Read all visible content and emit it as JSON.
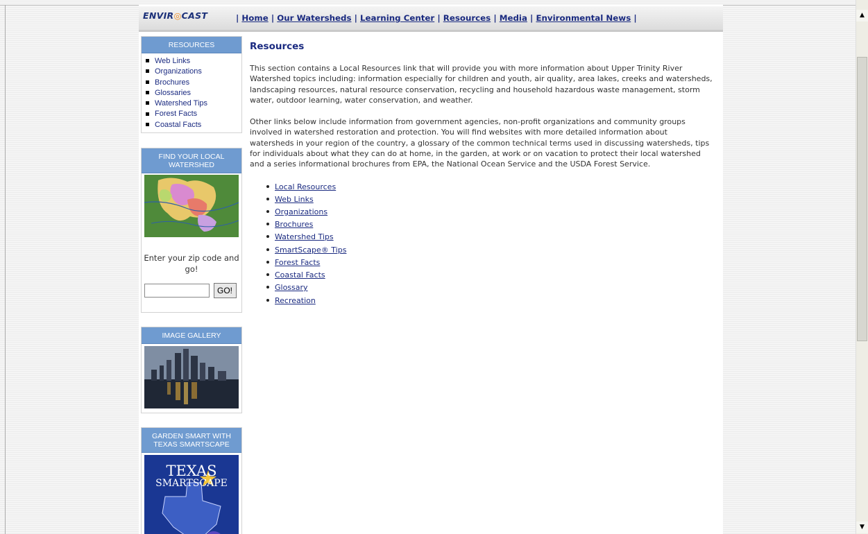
{
  "header": {
    "logo_text_a": "ENVIR",
    "logo_text_b": "CAST",
    "nav": [
      {
        "label": "Home"
      },
      {
        "label": "Our Watersheds"
      },
      {
        "label": "Learning Center"
      },
      {
        "label": "Resources"
      },
      {
        "label": "Media"
      },
      {
        "label": "Environmental News"
      }
    ]
  },
  "sidebar": {
    "resources_title": "RESOURCES",
    "resources_items": [
      "Web Links",
      "Organizations",
      "Brochures",
      "Glossaries",
      "Watershed Tips",
      "Forest Facts",
      "Coastal Facts"
    ],
    "watershed_title": "FIND YOUR LOCAL WATERSHED",
    "zip_label": "Enter your zip code and go!",
    "zip_value": "",
    "go_label": "GO!",
    "gallery_title": "IMAGE GALLERY",
    "smartscape_title": "GARDEN SMART WITH TEXAS SMARTSCAPE",
    "smartscape_img_line1": "TEXAS",
    "smartscape_img_line2": "SMARTSCAPE"
  },
  "main": {
    "title": "Resources",
    "para1": "This section contains a Local Resources link that will provide you with more information about Upper Trinity River Watershed topics including: information especially for children and youth, air quality, area lakes, creeks and watersheds, landscaping resources, natural resource conservation, recycling and household hazardous waste management, storm water, outdoor learning, water conservation, and weather.",
    "para2": "Other links below include information from government agencies, non-profit organizations and community groups involved in watershed restoration and protection. You will find websites with more detailed information about watersheds in your region of the country, a glossary of the common technical terms used in discussing watersheds, tips for individuals about what they can do at home, in the garden, at work or on vacation to protect their local watershed and a series informational brochures from EPA, the National Ocean Service and the USDA Forest Service.",
    "links": [
      "Local Resources",
      "Web Links",
      "Organizations",
      "Brochures",
      "Watershed Tips",
      "SmartScape® Tips",
      "Forest Facts",
      "Coastal Facts",
      "Glossary",
      "Recreation"
    ]
  },
  "colors": {
    "box_header": "#6f9bd0",
    "link": "#1a2a80",
    "logo_accent": "#f08a1c"
  }
}
